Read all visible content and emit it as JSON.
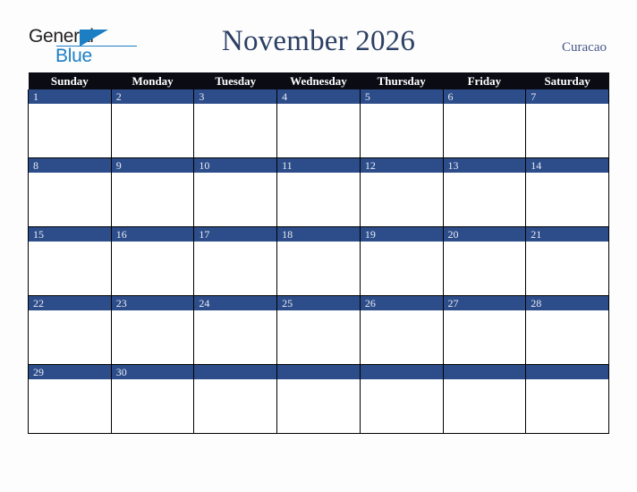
{
  "brand": {
    "name_part1": "General",
    "name_part2": "Blue",
    "triangle_color": "#1c7fc4"
  },
  "header": {
    "title": "November 2026",
    "region": "Curacao",
    "title_color": "#2b3f63",
    "region_color": "#46588a"
  },
  "calendar": {
    "header_bg": "#0b0b14",
    "daybar_bg": "#2d4d8a",
    "weekday_headers": [
      "Sunday",
      "Monday",
      "Tuesday",
      "Wednesday",
      "Thursday",
      "Friday",
      "Saturday"
    ],
    "weeks": [
      {
        "days": [
          {
            "number": "1"
          },
          {
            "number": "2"
          },
          {
            "number": "3"
          },
          {
            "number": "4"
          },
          {
            "number": "5"
          },
          {
            "number": "6"
          },
          {
            "number": "7"
          }
        ]
      },
      {
        "days": [
          {
            "number": "8"
          },
          {
            "number": "9"
          },
          {
            "number": "10"
          },
          {
            "number": "11"
          },
          {
            "number": "12"
          },
          {
            "number": "13"
          },
          {
            "number": "14"
          }
        ]
      },
      {
        "days": [
          {
            "number": "15"
          },
          {
            "number": "16"
          },
          {
            "number": "17"
          },
          {
            "number": "18"
          },
          {
            "number": "19"
          },
          {
            "number": "20"
          },
          {
            "number": "21"
          }
        ]
      },
      {
        "days": [
          {
            "number": "22"
          },
          {
            "number": "23"
          },
          {
            "number": "24"
          },
          {
            "number": "25"
          },
          {
            "number": "26"
          },
          {
            "number": "27"
          },
          {
            "number": "28"
          }
        ]
      },
      {
        "days": [
          {
            "number": "29"
          },
          {
            "number": "30"
          },
          {
            "number": ""
          },
          {
            "number": ""
          },
          {
            "number": ""
          },
          {
            "number": ""
          },
          {
            "number": ""
          }
        ]
      }
    ]
  }
}
